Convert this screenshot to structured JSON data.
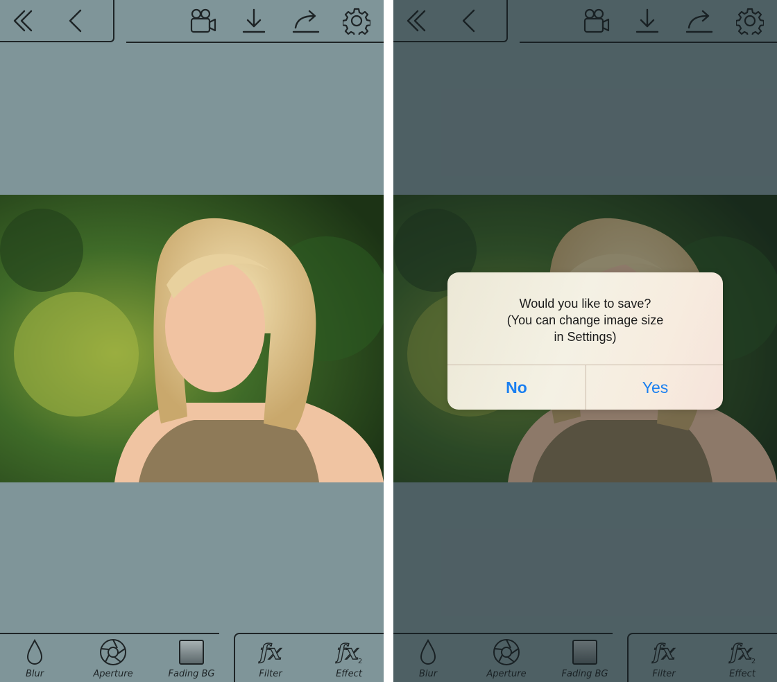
{
  "toolbar": {
    "icons": [
      "double-chevron-left-icon",
      "chevron-left-icon",
      "video-camera-icon",
      "download-icon",
      "share-icon",
      "gear-icon"
    ]
  },
  "tools": [
    {
      "label": "Blur",
      "icon": "drop-icon"
    },
    {
      "label": "Aperture",
      "icon": "aperture-icon"
    },
    {
      "label": "Fading BG",
      "icon": "square-icon"
    },
    {
      "label": "Filter",
      "icon": "fx-icon"
    },
    {
      "label": "Effect",
      "icon": "fx2-icon"
    }
  ],
  "dialog": {
    "line1": "Would you like to save?",
    "line2": "(You can change image size",
    "line3": "in Settings)",
    "no_label": "No",
    "yes_label": "Yes"
  },
  "colors": {
    "background": "#7f9599",
    "icon_stroke": "#1e2426",
    "alert_button": "#1a7ff0"
  }
}
